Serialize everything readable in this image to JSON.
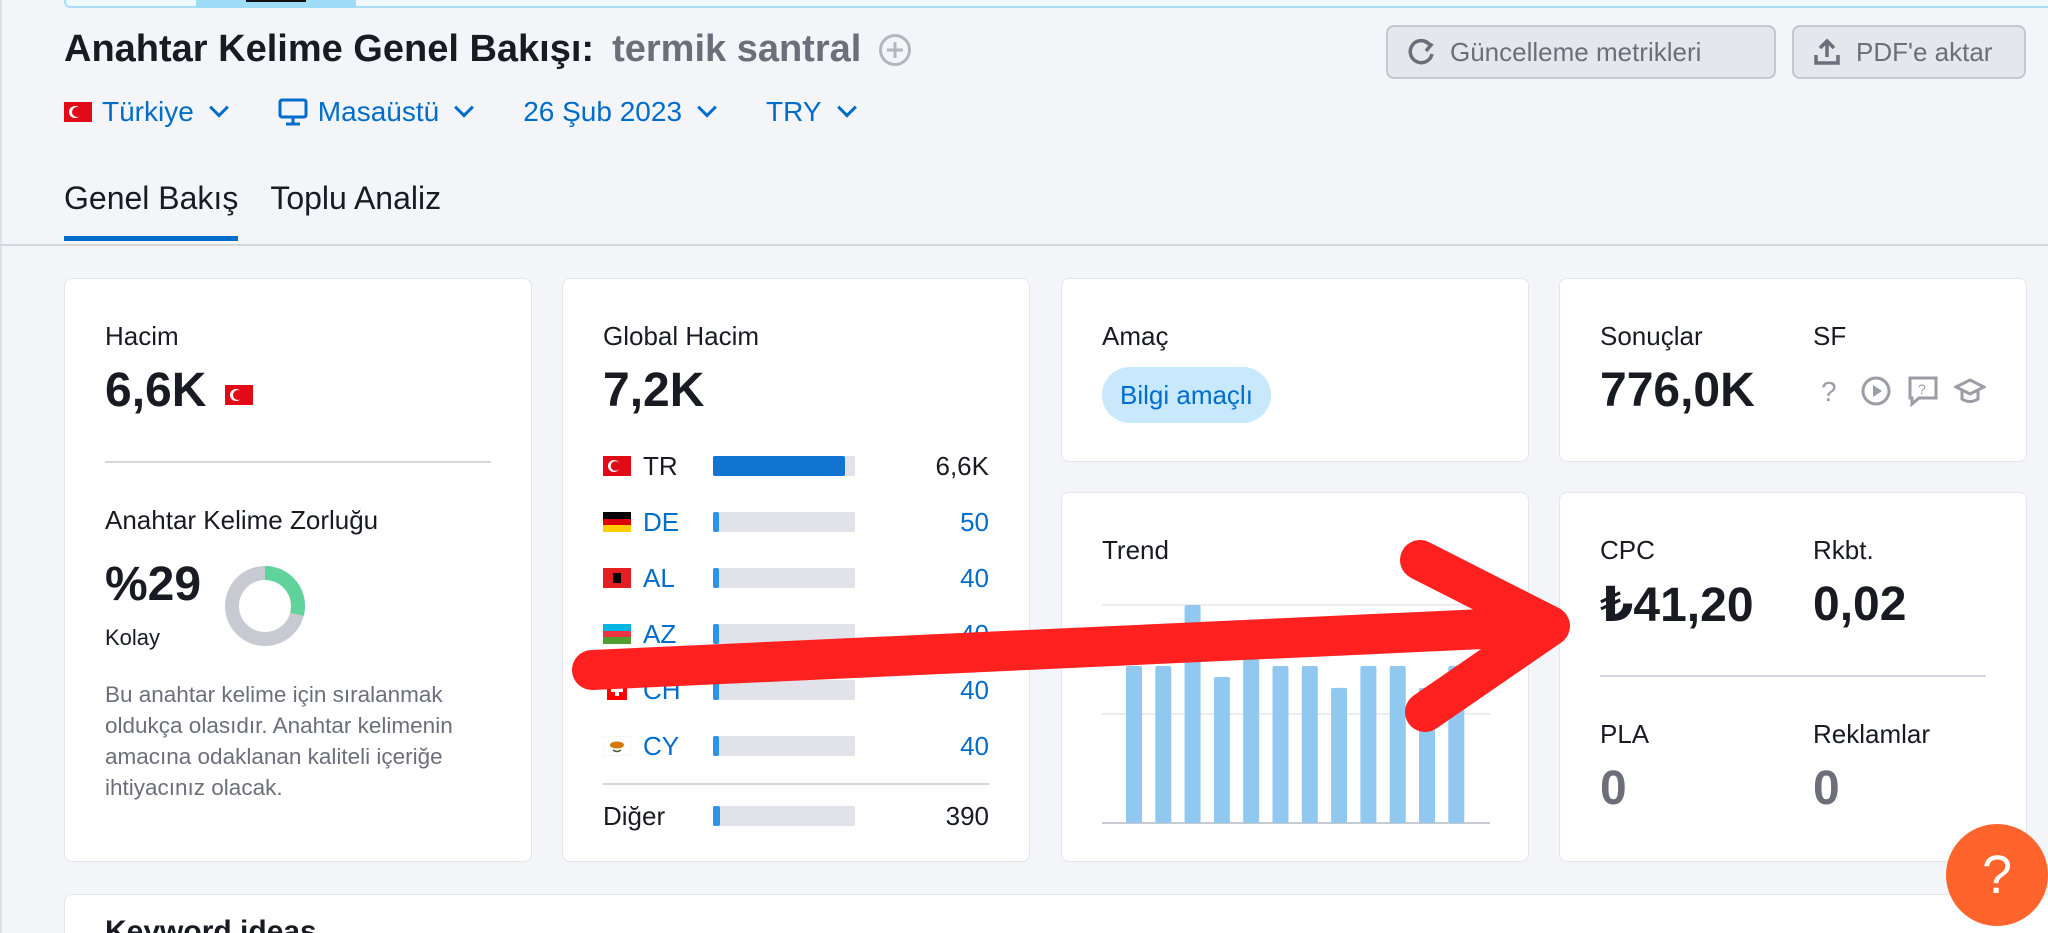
{
  "header": {
    "title": "Anahtar Kelime Genel Bakışı:",
    "keyword": "termik santral",
    "refresh_label": "Güncelleme metrikleri",
    "export_label": "PDF'e aktar"
  },
  "filters": {
    "country": "Türkiye",
    "device": "Masaüstü",
    "date": "26 Şub 2023",
    "currency": "TRY"
  },
  "tabs": [
    "Genel Bakış",
    "Toplu Analiz"
  ],
  "volume": {
    "label": "Hacim",
    "value": "6,6K",
    "kd_label": "Anahtar Kelime Zorluğu",
    "kd_value": "%29",
    "kd_percent": 29,
    "kd_level": "Kolay",
    "kd_description": "Bu anahtar kelime için sıralanmak oldukça olasıdır. Anahtar kelimenin amacına odaklanan kaliteli içeriğe ihtiyacınız olacak."
  },
  "global_volume": {
    "label": "Global Hacim",
    "value": "7,2K",
    "countries": [
      {
        "code": "TR",
        "value": "6,6K",
        "share": 0.93
      },
      {
        "code": "DE",
        "value": "50",
        "share": 0.04
      },
      {
        "code": "AL",
        "value": "40",
        "share": 0.04
      },
      {
        "code": "AZ",
        "value": "40",
        "share": 0.04
      },
      {
        "code": "CH",
        "value": "40",
        "share": 0.04
      },
      {
        "code": "CY",
        "value": "40",
        "share": 0.04
      }
    ],
    "other_label": "Diğer",
    "other_value": "390",
    "other_share": 0.05
  },
  "intent": {
    "label": "Amaç",
    "badge": "Bilgi amaçlı"
  },
  "trend": {
    "label": "Trend",
    "values": [
      0.72,
      0.72,
      1.0,
      0.67,
      0.77,
      0.72,
      0.72,
      0.62,
      0.72,
      0.72,
      0.62,
      0.72
    ]
  },
  "results": {
    "label": "Sonuçlar",
    "value": "776,0K",
    "sf_label": "SF",
    "sf_icons": [
      "question-icon",
      "video-icon",
      "faq-icon",
      "education-icon"
    ]
  },
  "cpc": {
    "cpc_label": "CPC",
    "cpc_value": "₺41,20",
    "comp_label": "Rkbt.",
    "comp_value": "0,02",
    "pla_label": "PLA",
    "pla_value": "0",
    "ads_label": "Reklamlar",
    "ads_value": "0"
  },
  "keyword_ideas": {
    "label": "Keyword ideas"
  },
  "help": {
    "label": "?"
  },
  "colors": {
    "accent": "#006dca",
    "annotation_arrow": "#ff2020",
    "help_button": "#ff642d",
    "kd_green": "#5fd39b"
  }
}
